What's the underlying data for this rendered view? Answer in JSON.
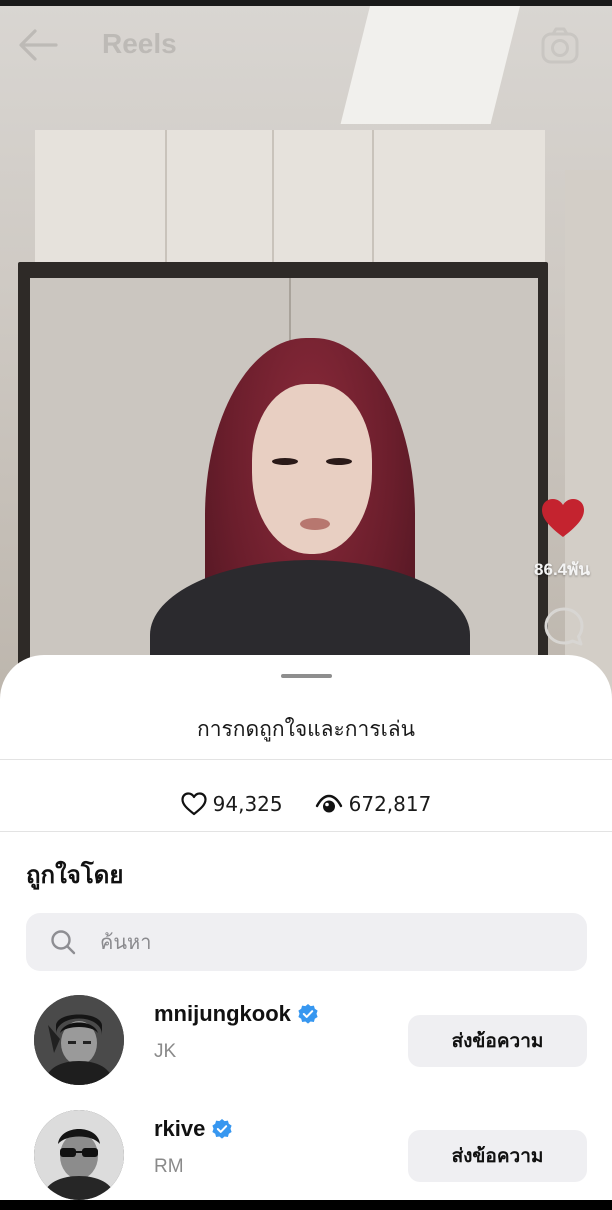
{
  "header": {
    "title": "Reels",
    "back_icon": "arrow-left-icon",
    "camera_icon": "camera-icon"
  },
  "reel": {
    "like_count": "86.4พัน",
    "like_color": "#c4232f"
  },
  "sheet": {
    "title": "การกดถูกใจและการเล่น",
    "likes": "94,325",
    "plays": "672,817",
    "liked_by_title": "ถูกใจโดย",
    "search_placeholder": "ค้นหา",
    "users": [
      {
        "username": "mnijungkook",
        "display_name": "JK",
        "verified": true,
        "button_label": "ส่งข้อความ"
      },
      {
        "username": "rkive",
        "display_name": "RM",
        "verified": true,
        "button_label": "ส่งข้อความ"
      }
    ]
  },
  "colors": {
    "verified": "#3797f0",
    "sheet_bg": "#ffffff",
    "button_bg": "#efeff2"
  }
}
